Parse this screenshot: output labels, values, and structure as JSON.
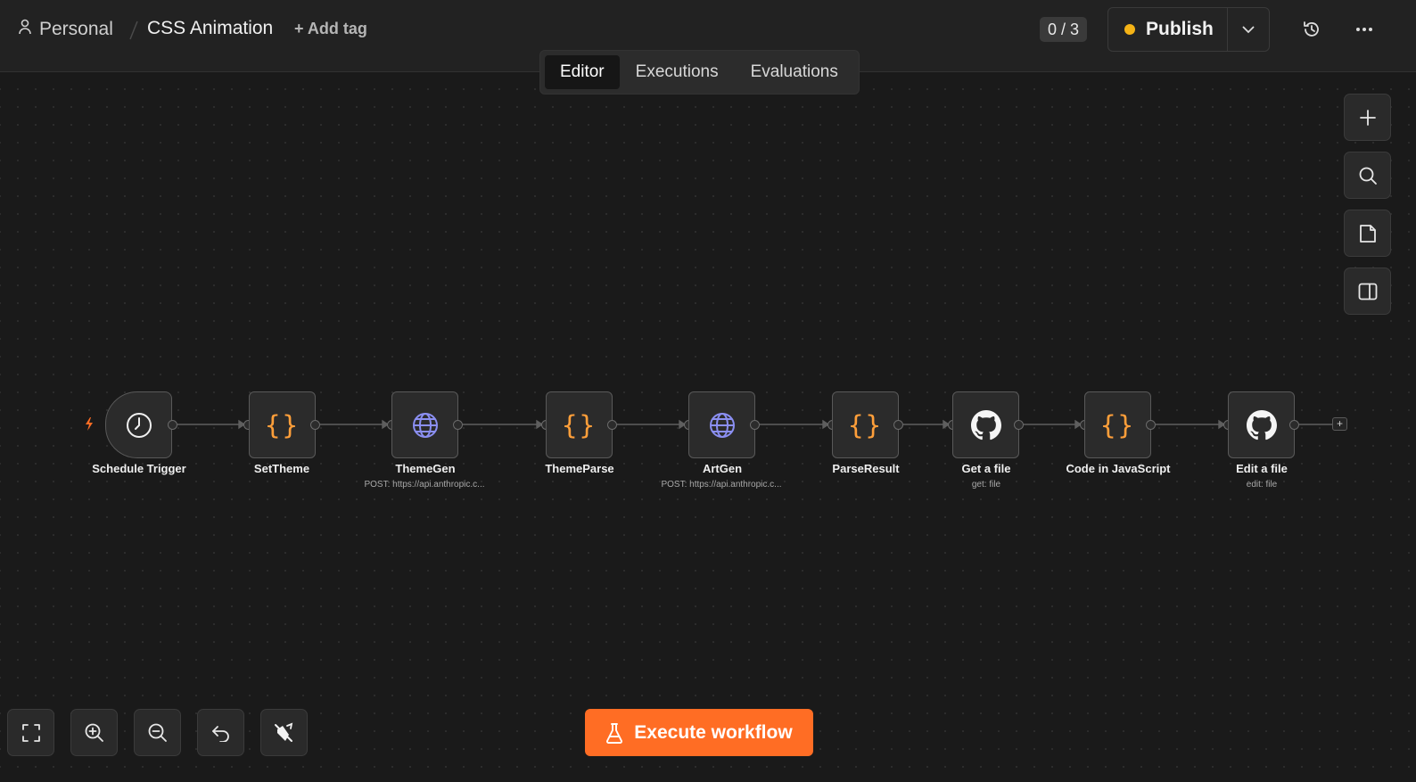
{
  "header": {
    "project": "Personal",
    "workflow_title": "CSS Animation",
    "add_tag": "+ Add tag",
    "counter": "0 / 3",
    "publish_label": "Publish",
    "status_color": "#f5b316"
  },
  "tabs": [
    {
      "label": "Editor",
      "active": true
    },
    {
      "label": "Executions",
      "active": false
    },
    {
      "label": "Evaluations",
      "active": false
    }
  ],
  "execute_label": "Execute workflow",
  "accent_color": "#ff6d24",
  "nodes": [
    {
      "label": "Schedule Trigger",
      "sub": "",
      "icon": "clock-icon"
    },
    {
      "label": "SetTheme",
      "sub": "",
      "icon": "code-braces-icon"
    },
    {
      "label": "ThemeGen",
      "sub": "POST: https://api.anthropic.c...",
      "icon": "globe-icon"
    },
    {
      "label": "ThemeParse",
      "sub": "",
      "icon": "code-braces-icon"
    },
    {
      "label": "ArtGen",
      "sub": "POST: https://api.anthropic.c...",
      "icon": "globe-icon"
    },
    {
      "label": "ParseResult",
      "sub": "",
      "icon": "code-braces-icon"
    },
    {
      "label": "Get a file",
      "sub": "get: file",
      "icon": "github-icon"
    },
    {
      "label": "Code in JavaScript",
      "sub": "",
      "icon": "code-braces-icon"
    },
    {
      "label": "Edit a file",
      "sub": "edit: file",
      "icon": "github-icon"
    }
  ],
  "right_toolbar": [
    "plus-icon",
    "search-icon",
    "sticky-note-icon",
    "panel-icon"
  ],
  "bottom_toolbar": [
    "fit-view-icon",
    "zoom-in-icon",
    "zoom-out-icon",
    "undo-icon",
    "clear-execution-icon"
  ]
}
